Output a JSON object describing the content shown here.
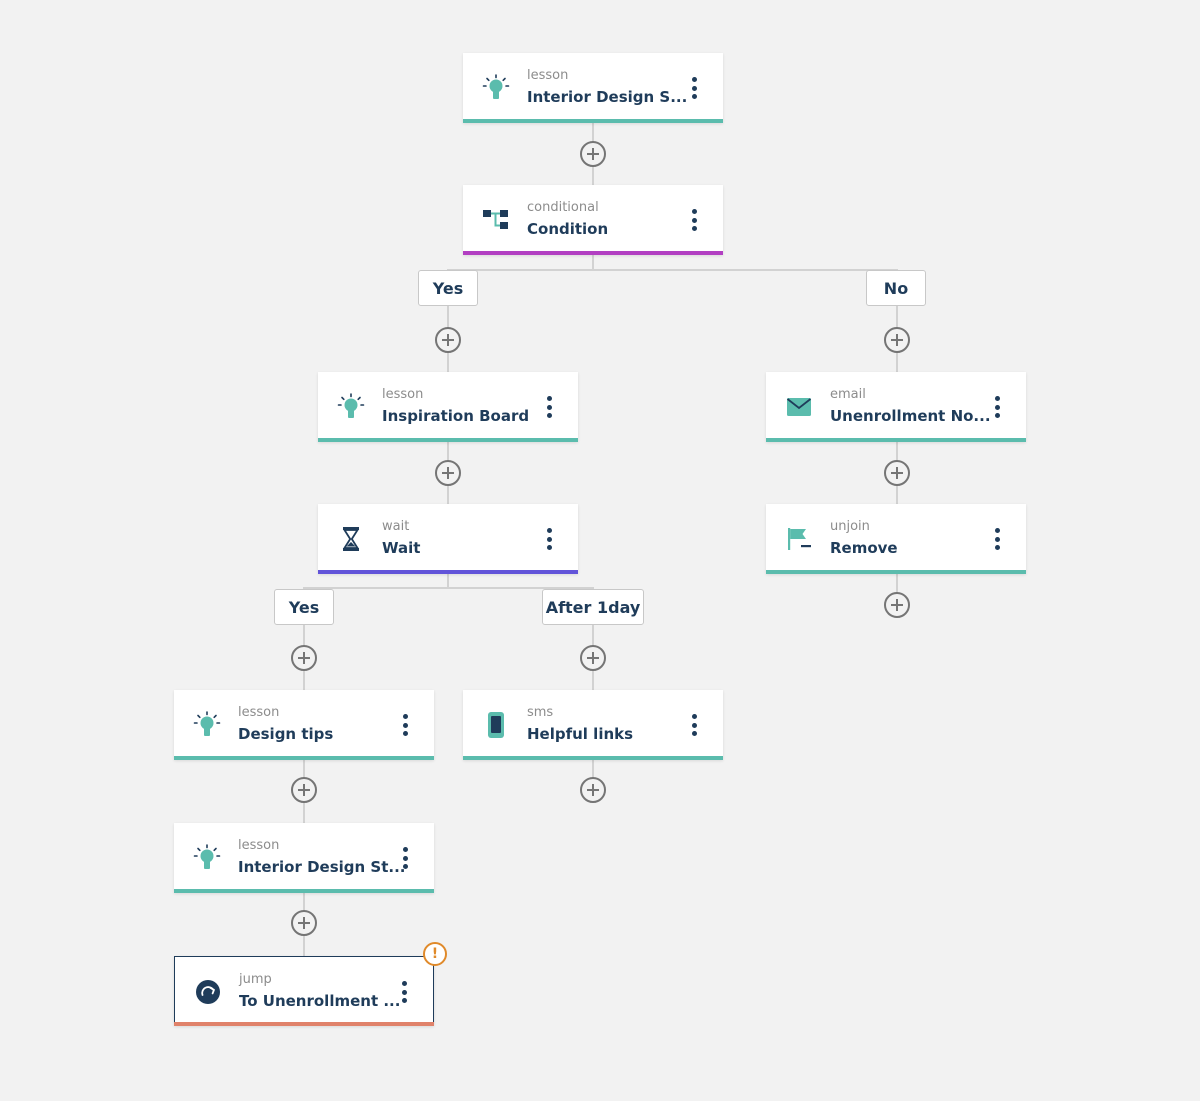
{
  "colors": {
    "lesson": "#5bbcad",
    "conditional": "#b23fc2",
    "wait": "#6254d9",
    "email": "#5bbcad",
    "unjoin": "#5bbcad",
    "sms": "#5bbcad",
    "jump": "#e0826a",
    "text_dark": "#1f3c5a",
    "warning": "#e08a2a"
  },
  "nodes": {
    "lesson_top": {
      "type": "lesson",
      "title": "Interior Design S...",
      "icon": "lightbulb-icon"
    },
    "conditional": {
      "type": "conditional",
      "title": "Condition",
      "icon": "conditional-icon"
    },
    "lesson_inspiration": {
      "type": "lesson",
      "title": "Inspiration Board",
      "icon": "lightbulb-icon"
    },
    "email": {
      "type": "email",
      "title": "Unenrollment No...",
      "icon": "envelope-icon"
    },
    "wait": {
      "type": "wait",
      "title": "Wait",
      "icon": "hourglass-icon"
    },
    "unjoin": {
      "type": "unjoin",
      "title": "Remove",
      "icon": "flag-icon"
    },
    "lesson_design_tips": {
      "type": "lesson",
      "title": "Design tips",
      "icon": "lightbulb-icon"
    },
    "sms": {
      "type": "sms",
      "title": "Helpful links",
      "icon": "phone-icon"
    },
    "lesson_interior_2": {
      "type": "lesson",
      "title": "Interior Design St...",
      "icon": "lightbulb-icon"
    },
    "jump": {
      "type": "jump",
      "title": "To Unenrollment ...",
      "icon": "jump-arrow-icon",
      "warning": "!"
    }
  },
  "branches": {
    "cond_yes": "Yes",
    "cond_no": "No",
    "wait_yes": "Yes",
    "wait_after": "After 1day"
  }
}
